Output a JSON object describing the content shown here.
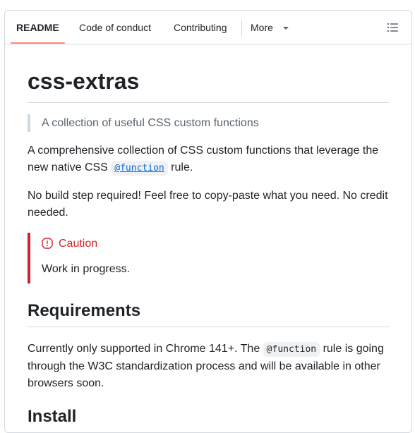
{
  "tabs": [
    {
      "label": "README",
      "active": true
    },
    {
      "label": "Code of conduct",
      "active": false
    },
    {
      "label": "Contributing",
      "active": false
    },
    {
      "label": "More",
      "active": false
    }
  ],
  "toc_icon": "list-unordered-icon",
  "readme": {
    "title": "css-extras",
    "tagline": "A collection of useful CSS custom functions",
    "intro_before": "A comprehensive collection of CSS custom functions that leverage the new native CSS ",
    "intro_code": "@function",
    "intro_after": " rule.",
    "no_build": "No build step required! Feel free to copy-paste what you need. No credit needed.",
    "caution": {
      "icon": "stop-icon",
      "title": "Caution",
      "body": "Work in progress.",
      "color": "#cf222e"
    },
    "requirements": {
      "heading": "Requirements",
      "text_before": "Currently only supported in Chrome 141+. The ",
      "code": "@function",
      "text_after": " rule is going through the W3C standardization process and will be available in other browsers soon."
    },
    "install_heading": "Install"
  },
  "colors": {
    "active_tab_underline": "#fd8c73",
    "link": "#0969da",
    "caution": "#d1242f"
  }
}
